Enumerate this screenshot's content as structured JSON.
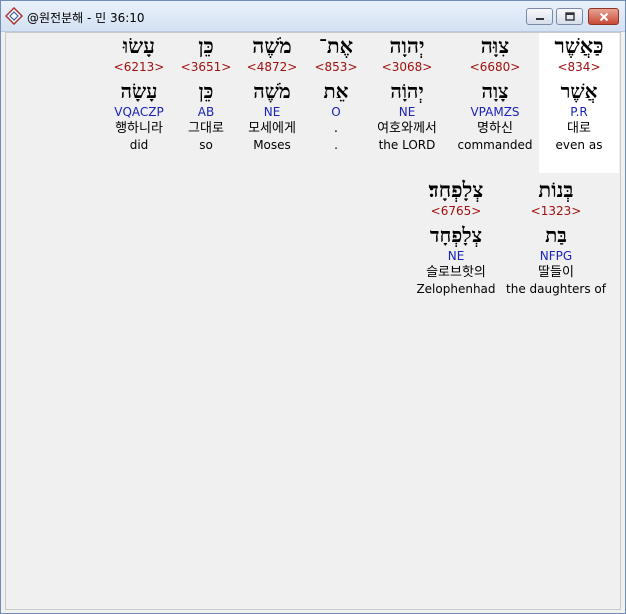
{
  "window": {
    "title": "@원전분해 - 민 36:10",
    "icon": "app-diamond-icon",
    "controls": [
      "minimize-icon",
      "maximize-icon",
      "close-icon"
    ]
  },
  "colors": {
    "strong": "#a01010",
    "morph": "#1b22b8",
    "selected_bg": "#ffffff"
  },
  "words": [
    {
      "hebrew": "כַּאֲשֶׁר",
      "strong": "<834>",
      "lemma": "אֲשֶׁר",
      "morph": "P.R",
      "korean": "대로",
      "english": "even as",
      "selected": true
    },
    {
      "hebrew": "צִוָּה",
      "strong": "<6680>",
      "lemma": "צָוָה",
      "morph": "VPAMZS",
      "korean": "명하신",
      "english": "commanded",
      "selected": false
    },
    {
      "hebrew": "יְהוָה",
      "strong": "<3068>",
      "lemma": "יְהוָֹה",
      "morph": "NE",
      "korean": "여호와께서",
      "english": "the LORD",
      "selected": false
    },
    {
      "hebrew": "אֶת־",
      "strong": "<853>",
      "lemma": "אֵת",
      "morph": "O",
      "korean": ".",
      "english": ".",
      "selected": false
    },
    {
      "hebrew": "מֹשֶׁה",
      "strong": "<4872>",
      "lemma": "מֹשֶׁה",
      "morph": "NE",
      "korean": "모세에게",
      "english": "Moses",
      "selected": false
    },
    {
      "hebrew": "כֵּן",
      "strong": "<3651>",
      "lemma": "כֵּן",
      "morph": "AB",
      "korean": "그대로",
      "english": "so",
      "selected": false
    },
    {
      "hebrew": "עָשׂוּ",
      "strong": "<6213>",
      "lemma": "עָשָׂה",
      "morph": "VQACZP",
      "korean": "행하니라",
      "english": "did",
      "selected": false
    },
    {
      "hebrew": "בְּנוֹת",
      "strong": "<1323>",
      "lemma": "בַּת",
      "morph": "NFPG",
      "korean": "딸들이",
      "english": "the daughters of",
      "selected": false
    },
    {
      "hebrew": "צְלָפְחָד׃",
      "strong": "<6765>",
      "lemma": "צְלָפְחָד",
      "morph": "NE",
      "korean": "슬로브핫의",
      "english": "Zelophenhad",
      "selected": false
    }
  ]
}
